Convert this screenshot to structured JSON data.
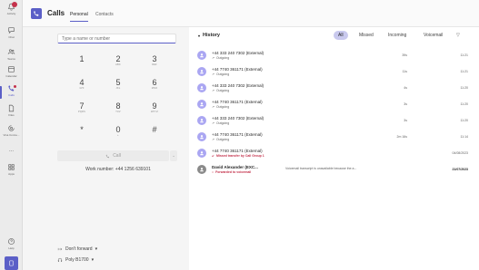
{
  "rail": {
    "items": [
      {
        "label": "Activity"
      },
      {
        "label": "Chat"
      },
      {
        "label": "Teams"
      },
      {
        "label": "Calendar"
      },
      {
        "label": "Calls"
      },
      {
        "label": "Files"
      },
      {
        "label": "Viva Conne..."
      },
      {
        "label": "..."
      },
      {
        "label": "Apps"
      },
      {
        "label": "Help"
      }
    ]
  },
  "header": {
    "title": "Calls",
    "tabs": [
      "Personal",
      "Contacts"
    ]
  },
  "dialpad": {
    "input_placeholder": "Type a name or number",
    "keys": [
      {
        "digit": "1",
        "letters": ""
      },
      {
        "digit": "2",
        "letters": "ABC"
      },
      {
        "digit": "3",
        "letters": "DEF"
      },
      {
        "digit": "4",
        "letters": "GHI"
      },
      {
        "digit": "5",
        "letters": "JKL"
      },
      {
        "digit": "6",
        "letters": "MNO"
      },
      {
        "digit": "7",
        "letters": "PQRS"
      },
      {
        "digit": "8",
        "letters": "TUV"
      },
      {
        "digit": "9",
        "letters": "WXYZ"
      },
      {
        "digit": "*",
        "letters": ""
      },
      {
        "digit": "0",
        "letters": "+"
      },
      {
        "digit": "#",
        "letters": ""
      }
    ],
    "call_label": "Call",
    "work_number": "Work number: +44 1256 639101"
  },
  "footer": {
    "forward": "Don't forward",
    "device": "Poly B1700"
  },
  "history": {
    "title": "History",
    "filters": [
      "All",
      "Missed",
      "Incoming",
      "Voicemail"
    ],
    "rows": [
      {
        "name": "+44 333 240 7302 (External)",
        "sub": "Outgoing",
        "duration": "39s",
        "time": "11:21",
        "type": "normal"
      },
      {
        "name": "+44 7740 361171 (External)",
        "sub": "Outgoing",
        "duration": "11s",
        "time": "11:21",
        "type": "normal"
      },
      {
        "name": "+44 333 240 7302 (External)",
        "sub": "Outgoing",
        "duration": "4s",
        "time": "11:20",
        "type": "normal"
      },
      {
        "name": "+44 7740 361171 (External)",
        "sub": "Outgoing",
        "duration": "3s",
        "time": "11:20",
        "type": "normal"
      },
      {
        "name": "+44 333 240 7302 (External)",
        "sub": "Outgoing",
        "duration": "3s",
        "time": "11:20",
        "type": "normal"
      },
      {
        "name": "+44 7740 361171 (External)",
        "sub": "Outgoing",
        "duration": "2m 16s",
        "time": "11:14",
        "type": "normal"
      },
      {
        "name": "+44 7740 361171 (External)",
        "sub": "Missed transfer by Call Group 1",
        "duration": "",
        "time": "04/08/2023",
        "type": "missed"
      },
      {
        "name": "David Alexander (EXC...",
        "sub": "Forwarded to voicemail",
        "duration": "",
        "time": "21/07/2023",
        "type": "voicemail",
        "transcript": "Voicemail transcript is unavailable because the a..."
      }
    ]
  },
  "colors": {
    "accent": "#5b5fc7",
    "avatar": "#aaa6f2",
    "missed": "#c4314b"
  }
}
